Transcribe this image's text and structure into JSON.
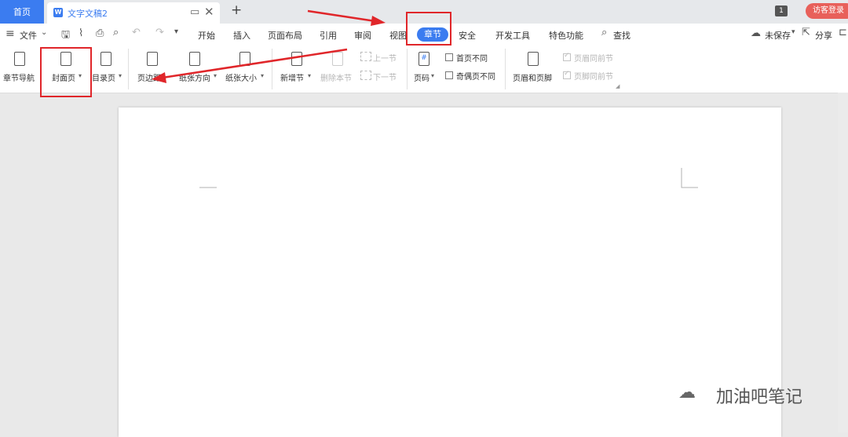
{
  "tabbar": {
    "home": "首页",
    "doc_title": "文字文稿2",
    "page_badge": "1",
    "guest_login": "访客登录"
  },
  "menubar": {
    "file": "文件",
    "items": [
      "开始",
      "插入",
      "页面布局",
      "引用",
      "审阅",
      "视图",
      "章节",
      "安全",
      "开发工具",
      "特色功能"
    ],
    "active": "章节",
    "search": "查找",
    "unsaved": "未保存",
    "share": "分享"
  },
  "ribbon": {
    "chapter_nav": "章节导航",
    "cover_page": "封面页",
    "toc_page": "目录页",
    "margins": "页边距",
    "orientation": "纸张方向",
    "paper_size": "纸张大小",
    "new_section": "新增节",
    "delete_section": "删除本节",
    "prev_section": "上一节",
    "next_section": "下一节",
    "page_number": "页码",
    "first_page_diff": "首页不同",
    "odd_even_diff": "奇偶页不同",
    "header_footer": "页眉和页脚",
    "header_same_prev": "页眉同前节",
    "footer_same_prev": "页脚同前节"
  },
  "watermark": {
    "text": "加油吧笔记"
  },
  "colors": {
    "accent": "#3b7cf0",
    "annotation_red": "#e0262a",
    "guest_button": "#e8605a"
  }
}
